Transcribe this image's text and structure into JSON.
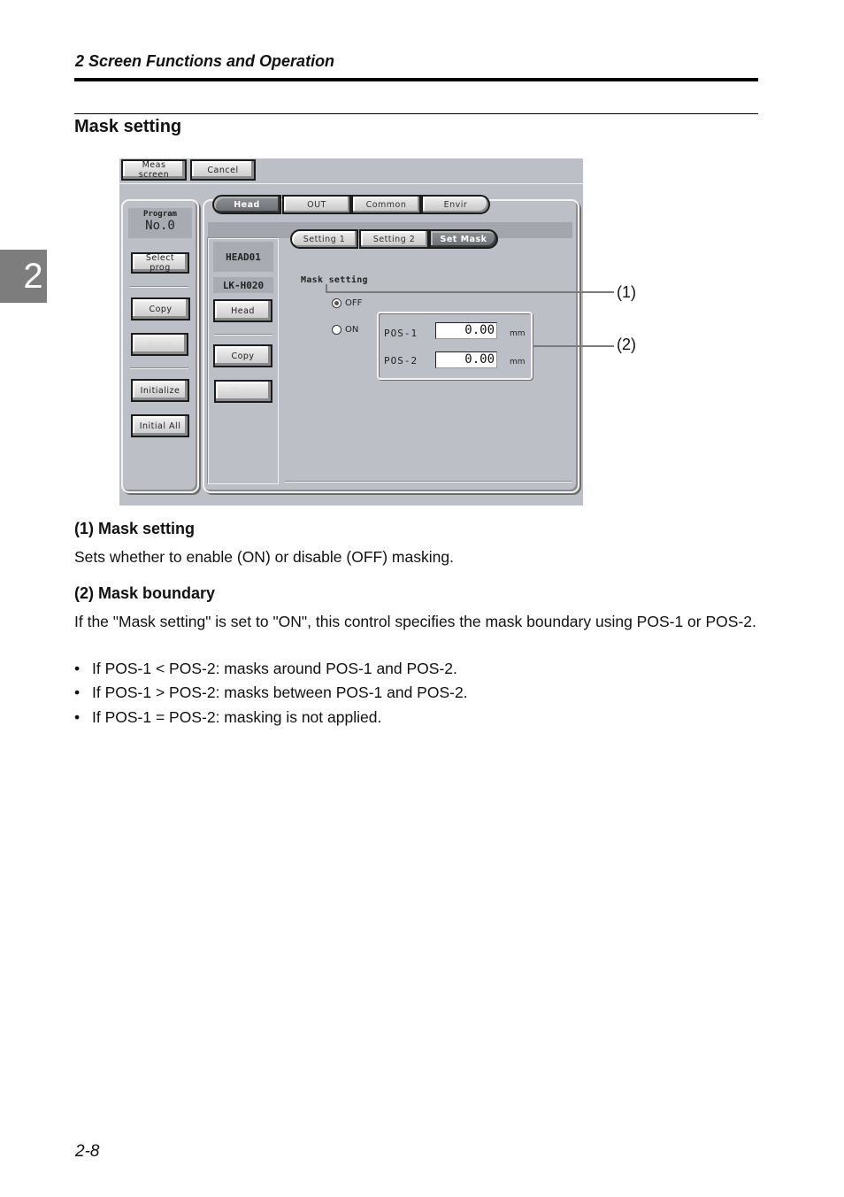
{
  "page": {
    "running_head": "2  Screen Functions and Operation",
    "chapter_tab": "2",
    "section_title": "Mask setting",
    "page_number": "2-8"
  },
  "screen": {
    "topbar": {
      "meas_screen_label": "Meas screen",
      "cancel_label": "Cancel"
    },
    "left_panel": {
      "program_label": "Program",
      "program_value": "No.0",
      "select_prog_label": "Select prog",
      "copy_label": "Copy",
      "paste_label": "Paste",
      "initialize_label": "Initialize",
      "initial_all_label": "Initial All"
    },
    "main_tabs": [
      {
        "label": "Head",
        "active": true
      },
      {
        "label": "OUT",
        "active": false
      },
      {
        "label": "Common",
        "active": false
      },
      {
        "label": "Envir",
        "active": false
      }
    ],
    "sub_tabs": [
      {
        "label": "Setting 1",
        "active": false
      },
      {
        "label": "Setting 2",
        "active": false
      },
      {
        "label": "Set Mask",
        "active": true
      }
    ],
    "head_panel": {
      "head_name": "HEAD01",
      "head_model": "LK-H020",
      "head_button_label": "Head",
      "copy_label": "Copy",
      "paste_label": "Paste"
    },
    "mask": {
      "label": "Mask setting",
      "options": [
        {
          "label": "OFF",
          "checked": true
        },
        {
          "label": "ON",
          "checked": false
        }
      ],
      "pos1_label": "POS-1",
      "pos1_value": "0.00",
      "pos2_label": "POS-2",
      "pos2_value": "0.00",
      "unit": "mm"
    }
  },
  "callouts": [
    "(1)",
    "(2)"
  ],
  "descriptions": [
    {
      "heading": "(1) Mask setting",
      "text": "Sets whether to enable (ON) or disable (OFF) masking."
    },
    {
      "heading": "(2) Mask boundary",
      "text": "If the \"Mask setting\" is set to \"ON\", this control specifies the mask boundary using POS-1 or POS-2.",
      "bullets": [
        "If POS-1 < POS-2: masks around POS-1 and POS-2.",
        "If POS-1 > POS-2: masks between POS-1 and POS-2.",
        "If POS-1 = POS-2: masking is not applied."
      ]
    }
  ],
  "colors": {
    "screen_bg": "#bcbfc5",
    "active_tab": "#7c8086",
    "chapter_tab": "#7d7d7d"
  }
}
